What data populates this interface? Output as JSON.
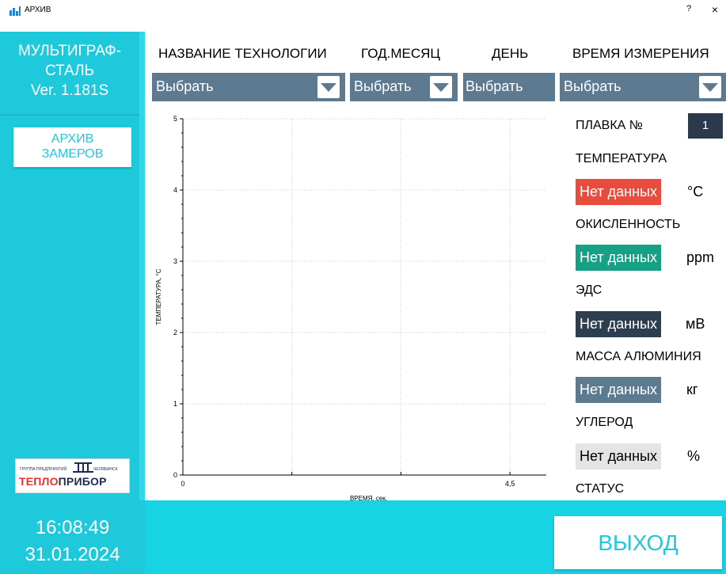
{
  "window": {
    "title": "АРХИВ",
    "help": "?",
    "close": "×"
  },
  "sidebar": {
    "app_name_line1": "МУЛЬТИГРАФ-",
    "app_name_line2": "СТАЛЬ",
    "app_version": "Ver. 1.181S",
    "archive_button_line1": "АРХИВ",
    "archive_button_line2": "ЗАМЕРОВ",
    "logo": {
      "small_left": "ГРУППА ПРЕДПРИЯТИЙ",
      "brand_red": "ТЕПЛО",
      "brand_blue": "ПРИБОР",
      "small_right": "ЧЕЛЯБИНСК"
    }
  },
  "filters": {
    "technology": {
      "label": "НАЗВАНИЕ ТЕХНОЛОГИИ",
      "value": "Выбрать"
    },
    "year_month": {
      "label": "ГОД.МЕСЯЦ",
      "value": "Выбрать"
    },
    "day": {
      "label": "ДЕНЬ",
      "value": "Выбрать"
    },
    "time": {
      "label": "ВРЕМЯ ИЗМЕРЕНИЯ",
      "value": "Выбрать"
    }
  },
  "chart_data": {
    "type": "line",
    "title": "",
    "xlabel": "ВРЕМЯ, сек.",
    "ylabel": "ТЕМПЕРАТУРА, °C",
    "xlim": [
      0,
      5
    ],
    "ylim": [
      0,
      5
    ],
    "x_tick_labels": [
      "0",
      "4,5"
    ],
    "y_tick_labels": [
      "0",
      "1",
      "2",
      "3",
      "4",
      "5"
    ],
    "series": [],
    "grid": true
  },
  "readings": {
    "melt_label": "ПЛАВКА №",
    "melt_number": "1",
    "temperature": {
      "label": "ТЕМПЕРАТУРА",
      "value": "Нет данных",
      "unit": "°C",
      "color": "#e84c3d"
    },
    "oxidation": {
      "label": "ОКИСЛЕННОСТЬ",
      "value": "Нет данных",
      "unit": "ppm",
      "color": "#16a086"
    },
    "emf": {
      "label": "ЭДС",
      "value": "Нет данных",
      "unit": "мВ",
      "color": "#2c3e50"
    },
    "aluminium": {
      "label": "МАССА АЛЮМИНИЯ",
      "value": "Нет данных",
      "unit": "кг",
      "color": "#5c7b90"
    },
    "carbon": {
      "label": "УГЛЕРОД",
      "value": "Нет данных",
      "unit": "%",
      "color": "#e4e4e4"
    },
    "status_label": "СТАТУС"
  },
  "footer": {
    "time": "16:08:49",
    "date": "31.01.2024",
    "exit_label": "ВЫХОД"
  }
}
